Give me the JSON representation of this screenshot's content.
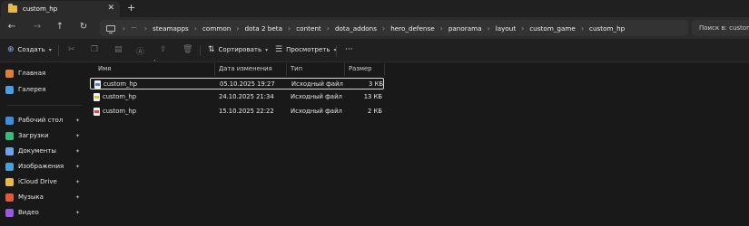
{
  "tab": {
    "title": "custom_hp",
    "close": "✕",
    "new": "+"
  },
  "nav": {
    "back": "←",
    "forward": "→",
    "up": "↑",
    "refresh": "↻"
  },
  "address": {
    "more": "···",
    "crumbs": [
      "steamapps",
      "common",
      "dota 2 beta",
      "content",
      "dota_addons",
      "hero_defense",
      "panorama",
      "layout",
      "custom_game",
      "custom_hp"
    ],
    "separator": "›"
  },
  "search": {
    "placeholder": "Поиск в: custom_hp"
  },
  "toolbar": {
    "create": "Создать",
    "sort": "Сортировать",
    "view": "Просмотреть",
    "more": "···"
  },
  "sidebar": {
    "items": [
      {
        "label": "Главная",
        "icon": "home-icon",
        "color": "#e07f3a"
      },
      {
        "label": "Галерея",
        "icon": "gallery-icon",
        "color": "#4a9fe0"
      },
      {
        "label": "Рабочий стол",
        "icon": "desktop-icon",
        "color": "#3a8fe0",
        "pinned": true
      },
      {
        "label": "Загрузки",
        "icon": "downloads-icon",
        "color": "#3ab87a",
        "pinned": true
      },
      {
        "label": "Документы",
        "icon": "documents-icon",
        "color": "#6aa6e8",
        "pinned": true
      },
      {
        "label": "Изображения",
        "icon": "images-icon",
        "color": "#4aa0d8",
        "pinned": true
      },
      {
        "label": "iCloud Drive",
        "icon": "icloud-icon",
        "color": "#e7b94a",
        "pinned": true
      },
      {
        "label": "Музыка",
        "icon": "music-icon",
        "color": "#e05a3a",
        "pinned": true
      },
      {
        "label": "Видео",
        "icon": "video-icon",
        "color": "#9a5ae0",
        "pinned": true
      }
    ],
    "pin": "📌"
  },
  "columns": {
    "name": "Имя",
    "modified": "Дата изменения",
    "type": "Тип",
    "size": "Размер"
  },
  "files": [
    {
      "name": "custom_hp",
      "modified": "05.10.2025 19:27",
      "type": "Исходный файл ...",
      "size": "3 КБ",
      "kind": "xml"
    },
    {
      "name": "custom_hp",
      "modified": "24.10.2025 21:34",
      "type": "Исходный файл J...",
      "size": "13 КБ",
      "kind": "js"
    },
    {
      "name": "custom_hp",
      "modified": "15.10.2025 22:22",
      "type": "Исходный файл ...",
      "size": "2 КБ",
      "kind": "css"
    }
  ]
}
